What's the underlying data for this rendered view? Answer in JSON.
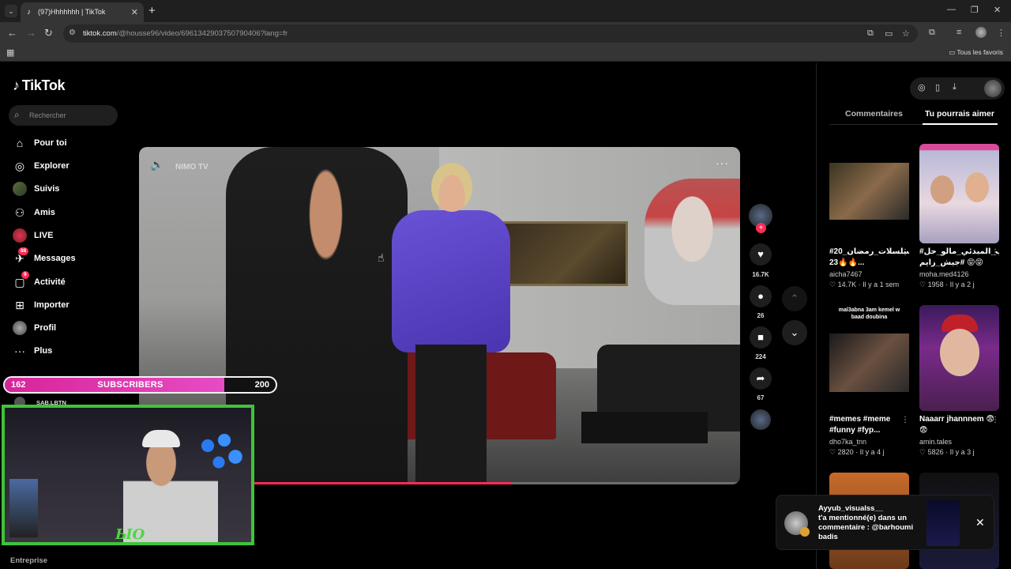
{
  "browser": {
    "tab_title": "(97)Hhhhhhh | TikTok",
    "url_host": "tiktok.com",
    "url_path": "/@housse96/video/6961342903750790406?lang=fr",
    "bookmarks_label": "Tous les favoris"
  },
  "tiktok": {
    "logo": "TikTok",
    "search_placeholder": "Rechercher",
    "nav": [
      {
        "label": "Pour toi",
        "icon": "home-icon"
      },
      {
        "label": "Explorer",
        "icon": "compass-icon"
      },
      {
        "label": "Suivis",
        "icon": "following-avatar-icon"
      },
      {
        "label": "Amis",
        "icon": "friends-icon"
      },
      {
        "label": "LIVE",
        "icon": "live-icon"
      },
      {
        "label": "Messages",
        "icon": "messages-icon",
        "badge": "88"
      },
      {
        "label": "Activité",
        "icon": "activity-icon",
        "badge": "9"
      },
      {
        "label": "Importer",
        "icon": "upload-icon"
      },
      {
        "label": "Profil",
        "icon": "profile-avatar-icon"
      },
      {
        "label": "Plus",
        "icon": "more-icon"
      }
    ],
    "footer": "Entreprise"
  },
  "video": {
    "watermark": "NIMO TV",
    "progress": 0.62,
    "likes": "16.7K",
    "comments": "26",
    "saves": "224",
    "shares": "67"
  },
  "right_panel": {
    "tabs": [
      "Commentaires",
      "Tu pourrais aimer"
    ],
    "active_tab": 1,
    "cards": [
      {
        "caption": "#20_مسلسلات_رمضان 🔥🔥23...",
        "user": "aicha7467",
        "likes": "14.7K",
        "time": "Il y a 1 sem"
      },
      {
        "caption": "#التحب_المبدئي_مالو_حل 😝😝 #جيش_زايم",
        "user": "moha.med4126",
        "likes": "1958",
        "time": "Il y a 2 j"
      },
      {
        "caption": "#memes #meme #funny #fyp...",
        "user": "dho7ka_tnn",
        "likes": "2820",
        "time": "Il y a 4 j",
        "thumb_text": "mal3abna 3am kemel w baad doubina"
      },
      {
        "caption": "Naaarr jhannnem 😨😨",
        "user": "amin.tales",
        "likes": "5826",
        "time": "Il y a 3 j"
      }
    ]
  },
  "notification": {
    "user": "Ayyub_visualss__",
    "text": "t'a mentionné(e) dans un commentaire : @barhoumi badis"
  },
  "overlay": {
    "current": "162",
    "label": "SUBSCRIBERS",
    "goal": "200",
    "fraction": 0.81,
    "chat_user": "SAB.LBTN"
  },
  "colors": {
    "accent": "#fe2c55",
    "overlay_fill": "#d8249a",
    "cam_border": "#3ec43a"
  }
}
